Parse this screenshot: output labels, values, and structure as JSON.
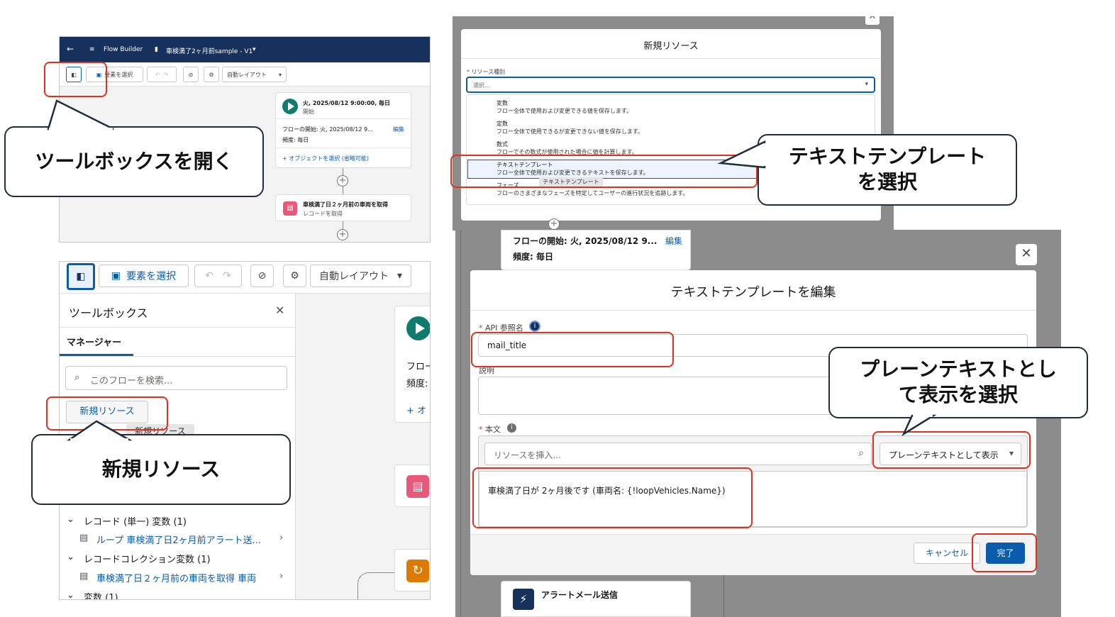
{
  "panel1": {
    "header": {
      "back": "←",
      "app": "Flow Builder",
      "flow_name": "車検満了2ヶ月前sample - V1"
    },
    "toolbar": {
      "select_elements": "要素を選択",
      "auto_layout": "自動レイアウト"
    },
    "start_card": {
      "schedule": "火, 2025/08/12 9:00:00, 毎日",
      "start_label": "開始",
      "flow_start": "フローの開始: 火, 2025/08/12 9...",
      "edit": "編集",
      "frequency": "頻度: 毎日",
      "add_object": "+ オブジェクトを選択 (省略可能)"
    },
    "get_records_card": {
      "title": "車検満了日２ヶ月前の車両を取得",
      "subtitle": "レコードを取得"
    }
  },
  "callouts": {
    "open_toolbox": "ツールボックスを開く",
    "new_resource": "新規リソース",
    "text_template_line1": "テキストテンプレート",
    "text_template_line2": "を選択",
    "plain_text_line1": "プレーンテキストとし",
    "plain_text_line2": "て表示を選択"
  },
  "panel2": {
    "toolbar": {
      "select_elements": "要素を選択",
      "auto_layout": "自動レイアウト"
    },
    "toolbox": {
      "title": "ツールボックス",
      "tab": "マネージャー",
      "search_placeholder": "このフローを検索...",
      "new_resource_button": "新規リソース",
      "tooltip": "新規リソース",
      "sections": [
        {
          "label": "レコード (単一) 変数 (1)",
          "item": "ループ 車検満了日2ヶ月前アラート送..."
        },
        {
          "label": "レコードコレクション変数 (1)",
          "item": "車検満了日２ヶ月前の車両を取得 車両"
        },
        {
          "label": "変数 (1)"
        }
      ]
    },
    "canvas": {
      "flow_prefix": "フロー",
      "freq_prefix": "頻度:",
      "add_prefix": "+ オ"
    }
  },
  "panel3": {
    "title": "新規リソース",
    "resource_type_label": "リソース種別",
    "select_placeholder": "選択...",
    "options": [
      {
        "name": "変数",
        "desc": "フロー全体で使用および変更できる値を保存します。"
      },
      {
        "name": "定数",
        "desc": "フロー全体で使用できるが変更できない値を保存します。"
      },
      {
        "name": "数式",
        "desc": "フローでその数式が使用された場合に値を計算します。"
      },
      {
        "name": "テキストテンプレート",
        "desc": "フロー全体で使用および変更できるテキストを保存します。"
      },
      {
        "name": "フェーズ",
        "desc": "フローのさまざまなフェーズを特定してユーザーの進行状況を追跡します。"
      }
    ],
    "hover_tooltip": "テキストテンプレート"
  },
  "panel4": {
    "background_card": {
      "flow_start": "フローの開始: 火, 2025/08/12 9...",
      "edit": "編集",
      "frequency": "頻度: 毎日"
    },
    "title": "テキストテンプレートを編集",
    "api_label": "API 参照名",
    "api_value": "mail_title",
    "description_label": "説明",
    "body_label": "本文",
    "insert_placeholder": "リソースを挿入...",
    "display_mode": "プレーンテキストとして表示",
    "body_text": "車検満了日が 2ヶ月後です (車両名: {!loopVehicles.Name})",
    "cancel": "キャンセル",
    "done": "完了",
    "bottom_card": "アラートメール送信"
  }
}
